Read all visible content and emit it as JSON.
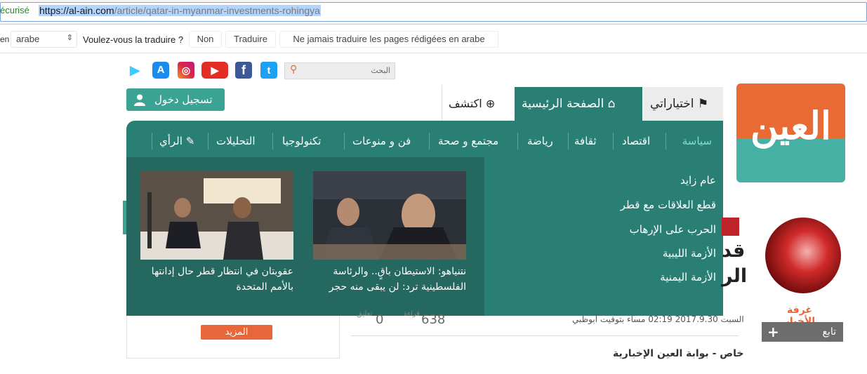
{
  "browser": {
    "security_label": "écurisé",
    "url_host": "https://al-ain.com",
    "url_path": "/article/qatar-in-myanmar-investments-rohingya"
  },
  "translate_bar": {
    "prefix": "en",
    "language": "arabe",
    "question": "Voulez-vous la traduire ?",
    "no_label": "Non",
    "translate_label": "Traduire",
    "never_label": "Ne jamais traduire les pages rédigées en arabe"
  },
  "header": {
    "search_placeholder": "البحث",
    "login_label": "تسجيل دخول",
    "logo_text": "العين",
    "social": {
      "twitter": "t",
      "facebook": "f",
      "youtube": "▶",
      "instagram": "◎",
      "appstore": "A",
      "play": "▶"
    }
  },
  "tabs": {
    "mine": "اختياراتي",
    "home": "الصفحة الرئيسية",
    "discover": "اكتشف"
  },
  "nav": {
    "items": [
      "سياسة",
      "اقتصاد",
      "ثقافة",
      "رياضة",
      "مجتمع و صحة",
      "فن و منوعات",
      "تكنولوجيا",
      "التحليلات",
      "الرأي"
    ]
  },
  "dropdown": {
    "links": [
      "عام زايد",
      "قطع العلاقات مع قطر",
      "الحرب على الإرهاب",
      "الأزمة الليبية",
      "الأزمة اليمنية"
    ],
    "cards": [
      {
        "title": "نتنياهو: الاستيطان باقٍ.. والرئاسة الفلسطينية ترد: لن يبقى منه حجر"
      },
      {
        "title": "عقوبتان في انتظار قطر حال إدانتها بالأمم المتحدة"
      }
    ]
  },
  "article": {
    "partial_line1": "قد",
    "partial_line2": "الر",
    "date": "السبت 2017.9.30 02:19 مساء بتوقيت أبوظبي",
    "views": "638",
    "views_label": "قراءة",
    "comments": "0",
    "comments_label": "تعليق",
    "byline": "خاص - بوابة العين الإخبارية"
  },
  "sidebar": {
    "newsroom_label": "غرفة الأخبار",
    "follow_label": "تابع",
    "more_label": "المزيد"
  },
  "colors": {
    "brand_teal": "#2a7f74",
    "accent_orange": "#e96a35",
    "active_nav": "#7ee0cf"
  }
}
